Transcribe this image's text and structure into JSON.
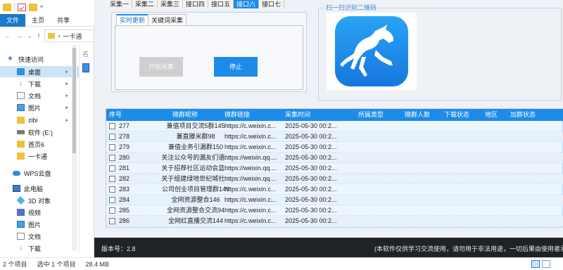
{
  "explorer": {
    "ribbon_tabs": [
      "文件",
      "主页",
      "共享"
    ],
    "address_path": "一卡通",
    "column_label": "名",
    "tree": [
      {
        "label": "快速访问",
        "icon": "star-icon"
      },
      {
        "label": "桌面",
        "icon": "desktop-icon"
      },
      {
        "label": "下载",
        "icon": "download-icon"
      },
      {
        "label": "文档",
        "icon": "document-icon"
      },
      {
        "label": "图片",
        "icon": "picture-icon"
      },
      {
        "label": "zibi",
        "icon": "folder-icon"
      },
      {
        "label": "软件 (E:)",
        "icon": "drive-icon"
      },
      {
        "label": "首页6",
        "icon": "folder-icon"
      },
      {
        "label": "一卡通",
        "icon": "folder-icon"
      },
      {
        "label": "WPS云盘",
        "icon": "cloud-icon"
      },
      {
        "label": "此电脑",
        "icon": "computer-icon"
      },
      {
        "label": "3D 对象",
        "icon": "3d-objects-icon"
      },
      {
        "label": "视频",
        "icon": "video-icon"
      },
      {
        "label": "图片",
        "icon": "picture-icon"
      },
      {
        "label": "文档",
        "icon": "document-icon"
      },
      {
        "label": "下载",
        "icon": "download-icon"
      }
    ],
    "status": {
      "item_count": "2 个项目",
      "selected": "选中 1 个项目",
      "size": "28.4 MB"
    }
  },
  "app": {
    "top_tabs": [
      "采集一",
      "采集二",
      "采集三",
      "接口四",
      "接口五",
      "接口六",
      "接口七"
    ],
    "active_top_tab": 5,
    "sub_tabs": [
      "实时更新",
      "关键词采集"
    ],
    "start_button": "开始采集",
    "stop_button": "停止",
    "qr_title": "扫一扫识别二维码",
    "columns": [
      "序号",
      "微群昵称",
      "微群链接",
      "采集时间",
      "所属类型",
      "微群人数",
      "下载状态",
      "地区",
      "加群状态"
    ],
    "rows": [
      {
        "id": "277",
        "name": "兼值项目交流5群145",
        "link": "https://c.weixin.c...",
        "time": "2025-05-30 00:2..."
      },
      {
        "id": "278",
        "name": "兼直滕米群98",
        "link": "https://c.weixin.c...",
        "time": "2025-05-30 00:2..."
      },
      {
        "id": "279",
        "name": "兼值业务引漏群150",
        "link": "https://c.weixin.c...",
        "time": "2025-05-30 00:2..."
      },
      {
        "id": "280",
        "name": "关注公众号的漏友们语...",
        "link": "https://weixin.qq....",
        "time": "2025-05-30 00:2..."
      },
      {
        "id": "281",
        "name": "关于招荐社区运动会篮...",
        "link": "https://weixin.qq....",
        "time": "2025-05-30 00:2..."
      },
      {
        "id": "282",
        "name": "关于组建绿地世纪城社...",
        "link": "https://weixin.qq....",
        "time": "2025-05-30 00:2..."
      },
      {
        "id": "283",
        "name": "公司创业项目管理群149",
        "link": "https://c.weixin.c...",
        "time": "2025-05-30 00:2..."
      },
      {
        "id": "284",
        "name": "全网资源整合146",
        "link": "https://c.weixin.c...",
        "time": "2025-05-30 00:2..."
      },
      {
        "id": "285",
        "name": "全网资源整合交流94",
        "link": "https://c.weixin.c...",
        "time": "2025-05-30 00:2..."
      },
      {
        "id": "286",
        "name": "全网红直播交流144",
        "link": "https://c.weixin.c...",
        "time": "2025-05-30 00:2..."
      }
    ],
    "version": "版本号：2.8",
    "disclaimer": "(本软件仅供学习交流使用，请勿用于非法用途，一切后果由使用者承担"
  },
  "colors": {
    "accent": "#1d8bea",
    "footer_bg": "#1f2327",
    "ribbon_file": "#1979ca"
  }
}
